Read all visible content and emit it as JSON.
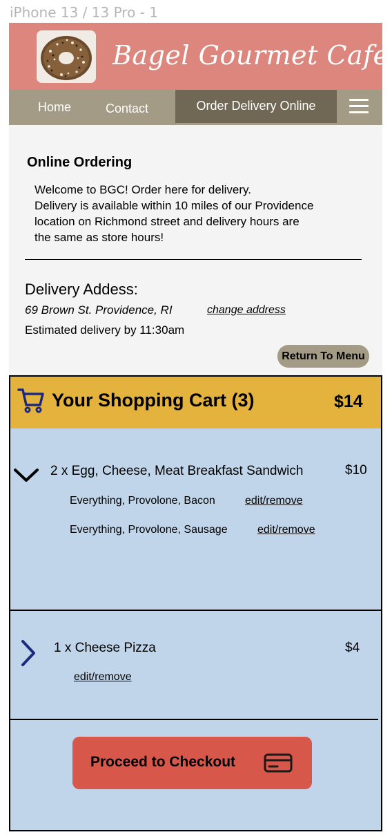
{
  "frame_label": "iPhone 13 / 13 Pro - 1",
  "header": {
    "brand": "Bagel Gourmet Cafe",
    "logo_icon": "bagel-photo"
  },
  "nav": {
    "items": [
      "Home",
      "Contact",
      "Order Delivery Online"
    ],
    "menu_icon": "hamburger-icon"
  },
  "intro": {
    "title": "Online Ordering",
    "lines": [
      "Welcome to BGC! Order here for delivery.",
      "Delivery is available within 10 miles of our Providence",
      "location on Richmond street and delivery hours are",
      "the same as store hours!"
    ]
  },
  "delivery": {
    "title": "Delivery Addess:",
    "address": "69 Brown St. Providence, RI",
    "change_label": "change address",
    "estimate": "Estimated delivery by 11:30am",
    "return_label": "Return To Menu"
  },
  "cart": {
    "title": "Your Shopping Cart (3)",
    "total": "$14",
    "icon": "shopping-cart-icon",
    "items": [
      {
        "title": "2 x Egg, Cheese, Meat Breakfast Sandwich",
        "price": "$10",
        "expanded": true,
        "options": [
          {
            "desc": "Everything, Provolone, Bacon",
            "action": "edit/remove"
          },
          {
            "desc": "Everything, Provolone, Sausage",
            "action": "edit/remove"
          }
        ]
      },
      {
        "title": "1 x Cheese Pizza",
        "price": "$4",
        "expanded": false,
        "action": "edit/remove"
      }
    ],
    "checkout_label": "Proceed to Checkout",
    "checkout_icon": "credit-card-icon"
  },
  "colors": {
    "header": "#dd867d",
    "nav": "#a39b86",
    "nav_active": "#706855",
    "cart_header": "#e3b33e",
    "cart_body": "#c0d5e9",
    "checkout": "#d7574a",
    "chevron_collapsed": "#1b2a7c"
  }
}
